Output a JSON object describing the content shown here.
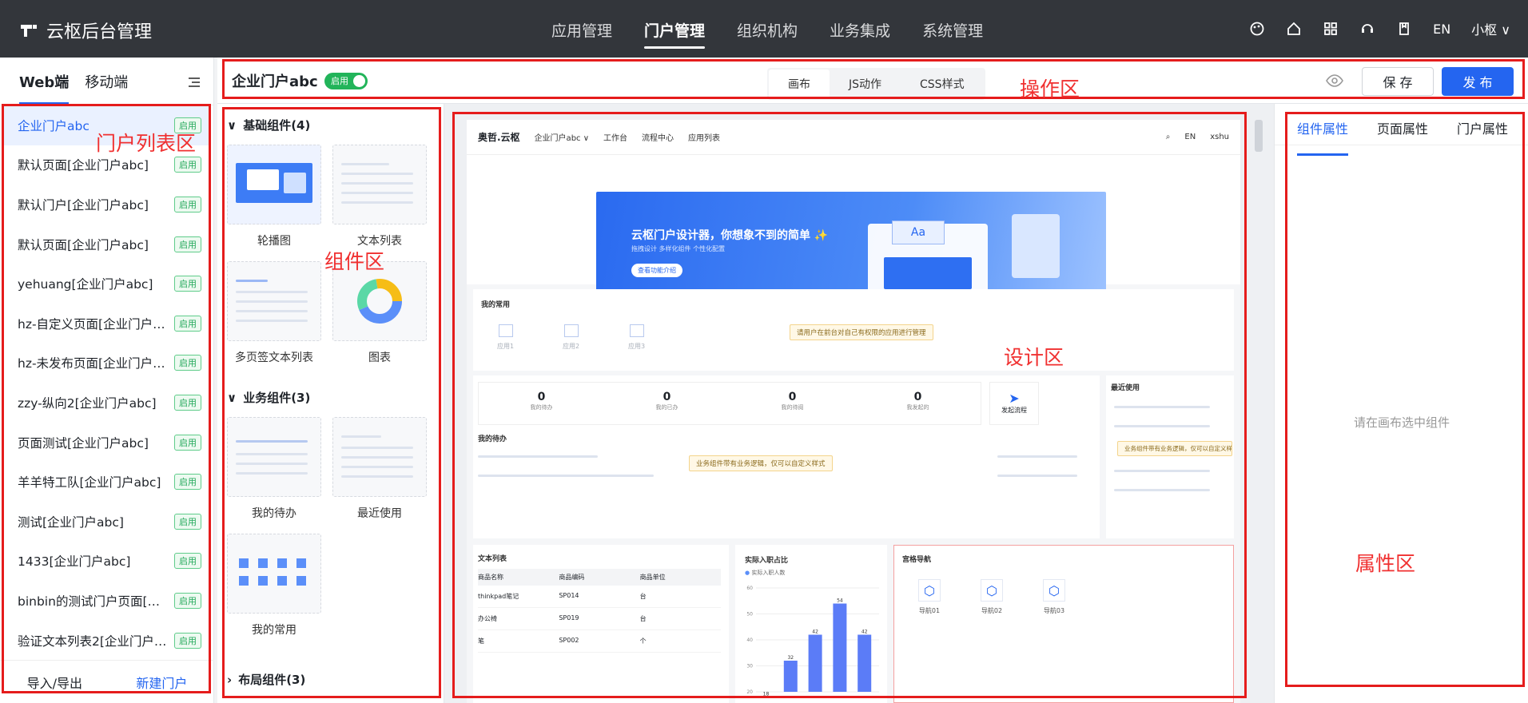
{
  "app": {
    "title": "云枢后台管理",
    "nav": [
      "应用管理",
      "门户管理",
      "组织机构",
      "业务集成",
      "系统管理"
    ],
    "active_nav": "门户管理",
    "lang": "EN",
    "user": "小枢"
  },
  "sidebar": {
    "tabs": [
      "Web端",
      "移动端"
    ],
    "badge": "启用",
    "items": [
      "企业门户abc",
      "默认页面[企业门户abc]",
      "默认门户[企业门户abc]",
      "默认页面[企业门户abc]",
      "yehuang[企业门户abc]",
      "hz-自定义页面[企业门户ab...",
      "hz-未发布页面[企业门户ab...",
      "zzy-纵向2[企业门户abc]",
      "页面测试[企业门户abc]",
      "羊羊特工队[企业门户abc]",
      "测试[企业门户abc]",
      "1433[企业门户abc]",
      "binbin的测试门户页面[企...",
      "验证文本列表2[企业门户a..."
    ],
    "import_export": "导入/导出",
    "new_portal": "新建门户"
  },
  "toolbar": {
    "portal_name": "企业门户abc",
    "status": "启用",
    "tabs": [
      "画布",
      "JS动作",
      "CSS样式"
    ],
    "save": "保 存",
    "publish": "发 布"
  },
  "components": {
    "group1": "基础组件(4)",
    "group1_items": [
      "轮播图",
      "文本列表",
      "多页签文本列表",
      "图表"
    ],
    "group2": "业务组件(3)",
    "group2_items": [
      "我的待办",
      "最近使用",
      "我的常用"
    ],
    "group3": "布局组件(3)"
  },
  "design": {
    "brand": "奥哲.云枢",
    "portal": "企业门户abc",
    "nav": [
      "工作台",
      "流程中心",
      "应用列表"
    ],
    "lang": "EN",
    "user": "xshu",
    "banner_title": "云枢门户设计器，你想象不到的简单 ✨",
    "banner_sub": "拖拽设计   多样化组件   个性化配置",
    "banner_btn": "查看功能介绍",
    "common_title": "我的常用",
    "common_items": [
      "应用1",
      "应用2",
      "应用3"
    ],
    "common_notice": "请用户在前台对自己有权限的应用进行管理",
    "stats": [
      {
        "value": "0",
        "label": "我的待办"
      },
      {
        "value": "0",
        "label": "我的已办"
      },
      {
        "value": "0",
        "label": "我的待阅"
      },
      {
        "value": "0",
        "label": "我发起的"
      }
    ],
    "start_flow": "发起流程",
    "todo_title": "我的待办",
    "todo_notice": "业务组件带有业务逻辑，仅可以自定义样式",
    "recent_title": "最近使用",
    "recent_notice": "业务组件带有业务逻辑，仅可以自定义样式",
    "text_list_title": "文本列表",
    "text_list_cols": [
      "商品名称",
      "商品编码",
      "商品单位"
    ],
    "text_list_rows": [
      [
        "thinkpad笔记",
        "SP014",
        "台"
      ],
      [
        "办公椅",
        "SP019",
        "台"
      ],
      [
        "笔",
        "SP002",
        "个"
      ]
    ],
    "chart_title": "实际入职占比",
    "chart_legend": "实际入职人数",
    "grid_nav_title": "宫格导航",
    "grid_nav_items": [
      "导航01",
      "导航02",
      "导航03"
    ]
  },
  "chart_data": {
    "type": "bar",
    "title": "实际入职占比",
    "series": [
      {
        "name": "实际入职人数",
        "values": [
          18,
          32,
          42,
          54,
          42
        ]
      }
    ],
    "ylim": [
      20,
      60
    ],
    "yticks": [
      20,
      30,
      40,
      50,
      60
    ]
  },
  "props": {
    "tabs": [
      "组件属性",
      "页面属性",
      "门户属性"
    ],
    "empty": "请在画布选中组件"
  },
  "annotations": {
    "portal_list": "门户列表区",
    "components": "组件区",
    "operation": "操作区",
    "design": "设计区",
    "properties": "属性区"
  }
}
